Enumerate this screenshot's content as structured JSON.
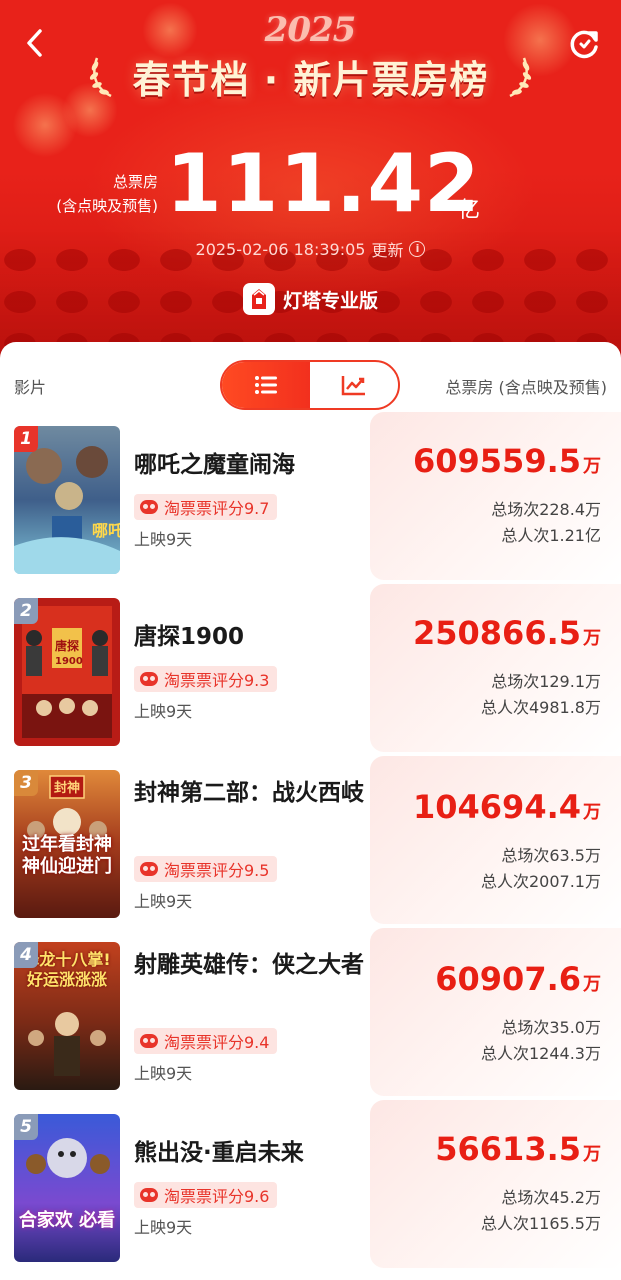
{
  "header": {
    "year": "2025",
    "title": "春节档 · 新片票房榜",
    "total_label_line1": "总票房",
    "total_label_line2": "(含点映及预售)",
    "total_value": "111.42",
    "total_unit": "亿",
    "updated_at": "2025-02-06 18:39:05",
    "updated_suffix": "更新",
    "brand_name": "灯塔专业版"
  },
  "list_header": {
    "film_col": "影片",
    "box_col": "总票房 (含点映及预售)"
  },
  "colors": {
    "accent": "#e81f14",
    "header_red": "#e8221a"
  },
  "movies": [
    {
      "rank": "1",
      "title": "哪吒之魔童闹海",
      "rating": "淘票票评分9.7",
      "days": "上映9天",
      "box_office": "609559.5",
      "unit": "万",
      "screenings": "总场次228.4万",
      "admissions": "总人次1.21亿"
    },
    {
      "rank": "2",
      "title": "唐探1900",
      "rating": "淘票票评分9.3",
      "days": "上映9天",
      "box_office": "250866.5",
      "unit": "万",
      "screenings": "总场次129.1万",
      "admissions": "总人次4981.8万"
    },
    {
      "rank": "3",
      "title": "封神第二部：战火西岐",
      "rating": "淘票票评分9.5",
      "days": "上映9天",
      "box_office": "104694.4",
      "unit": "万",
      "screenings": "总场次63.5万",
      "admissions": "总人次2007.1万",
      "poster_caption": "过年看封神 神仙迎进门"
    },
    {
      "rank": "4",
      "title": "射雕英雄传：侠之大者",
      "rating": "淘票票评分9.4",
      "days": "上映9天",
      "box_office": "60907.6",
      "unit": "万",
      "screenings": "总场次35.0万",
      "admissions": "总人次1244.3万",
      "poster_caption": "降龙十八掌! 好运涨涨涨"
    },
    {
      "rank": "5",
      "title": "熊出没·重启未来",
      "rating": "淘票票评分9.6",
      "days": "上映9天",
      "box_office": "56613.5",
      "unit": "万",
      "screenings": "总场次45.2万",
      "admissions": "总人次1165.5万",
      "poster_caption": "合家欢 必看"
    }
  ]
}
